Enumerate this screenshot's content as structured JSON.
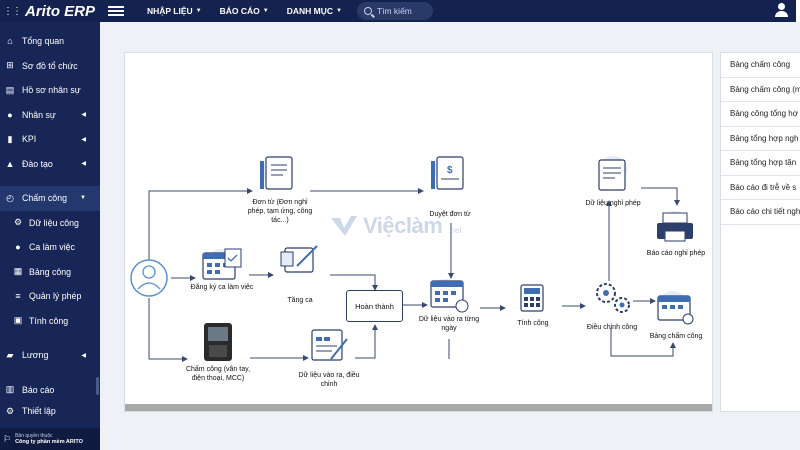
{
  "topbar": {
    "brand": "Arito ERP",
    "menu": [
      {
        "label": "NHẬP LIỆU"
      },
      {
        "label": "BÁO CÁO"
      },
      {
        "label": "DANH MỤC"
      }
    ],
    "search_placeholder": "Tìm kiếm"
  },
  "sidebar": {
    "items": [
      {
        "label": "Tổng quan",
        "icon": "home-icon"
      },
      {
        "label": "Sơ đồ tổ chức",
        "icon": "org-chart-icon"
      },
      {
        "label": "Hồ sơ nhân sự",
        "icon": "profile-icon"
      },
      {
        "label": "Nhân sự",
        "icon": "person-icon"
      },
      {
        "label": "KPI",
        "icon": "kpi-icon"
      },
      {
        "label": "Đào tạo",
        "icon": "graduation-icon"
      },
      {
        "label": "Chấm công",
        "icon": "clock-icon"
      },
      {
        "label": "Dữ liệu công",
        "icon": "gear-icon"
      },
      {
        "label": "Ca làm việc",
        "icon": "person-icon"
      },
      {
        "label": "Bảng công",
        "icon": "table-icon"
      },
      {
        "label": "Quản lý phép",
        "icon": "list-icon"
      },
      {
        "label": "Tính công",
        "icon": "calc-icon"
      },
      {
        "label": "Lương",
        "icon": "money-icon"
      },
      {
        "label": "Báo cáo",
        "icon": "report-icon"
      },
      {
        "label": "Thiết lập",
        "icon": "settings-icon"
      }
    ],
    "footer_line1": "Bản quyền thuộc",
    "footer_line2": "Công ty phần mềm ARITO"
  },
  "diagram": {
    "nodes": {
      "don_tu": "Đơn từ (Đơn nghỉ phép, tạm ứng, công tác...)",
      "dang_ky_ca": "Đăng ký ca làm việc",
      "cham_cong": "Chấm công (vân tay, điện thoại, MCC)",
      "tang_ca": "Tăng ca",
      "hoan_thanh": "Hoàn thành",
      "du_lieu_vao_ra_dc": "Dữ liệu vào ra, điều chỉnh",
      "duyet_don_tu": "Duyệt đơn từ",
      "du_lieu_vao_ra_ngay": "Dữ liệu vào ra từng ngày",
      "tinh_cong": "Tính công",
      "du_lieu_nghi_phep": "Dữ liệu nghỉ phép",
      "dieu_chinh_cong": "Điều chỉnh công",
      "bao_cao_nghi_phep": "Báo cáo nghỉ phép",
      "bang_cham_cong": "Bảng chấm công"
    },
    "watermark_text": "Việclàm",
    "watermark_suffix": ".net"
  },
  "reports": [
    "Bảng chấm công",
    "Bảng chấm công (m",
    "Bảng công tổng hợ",
    "Bảng tổng hợp ngh",
    "Bảng tổng hợp tăn",
    "Báo cáo đi trễ về s",
    "Báo cáo chi tiết ngh"
  ],
  "colors": {
    "topbar": "#13224e",
    "sidebar": "#172656",
    "accent": "#3f6db3"
  }
}
